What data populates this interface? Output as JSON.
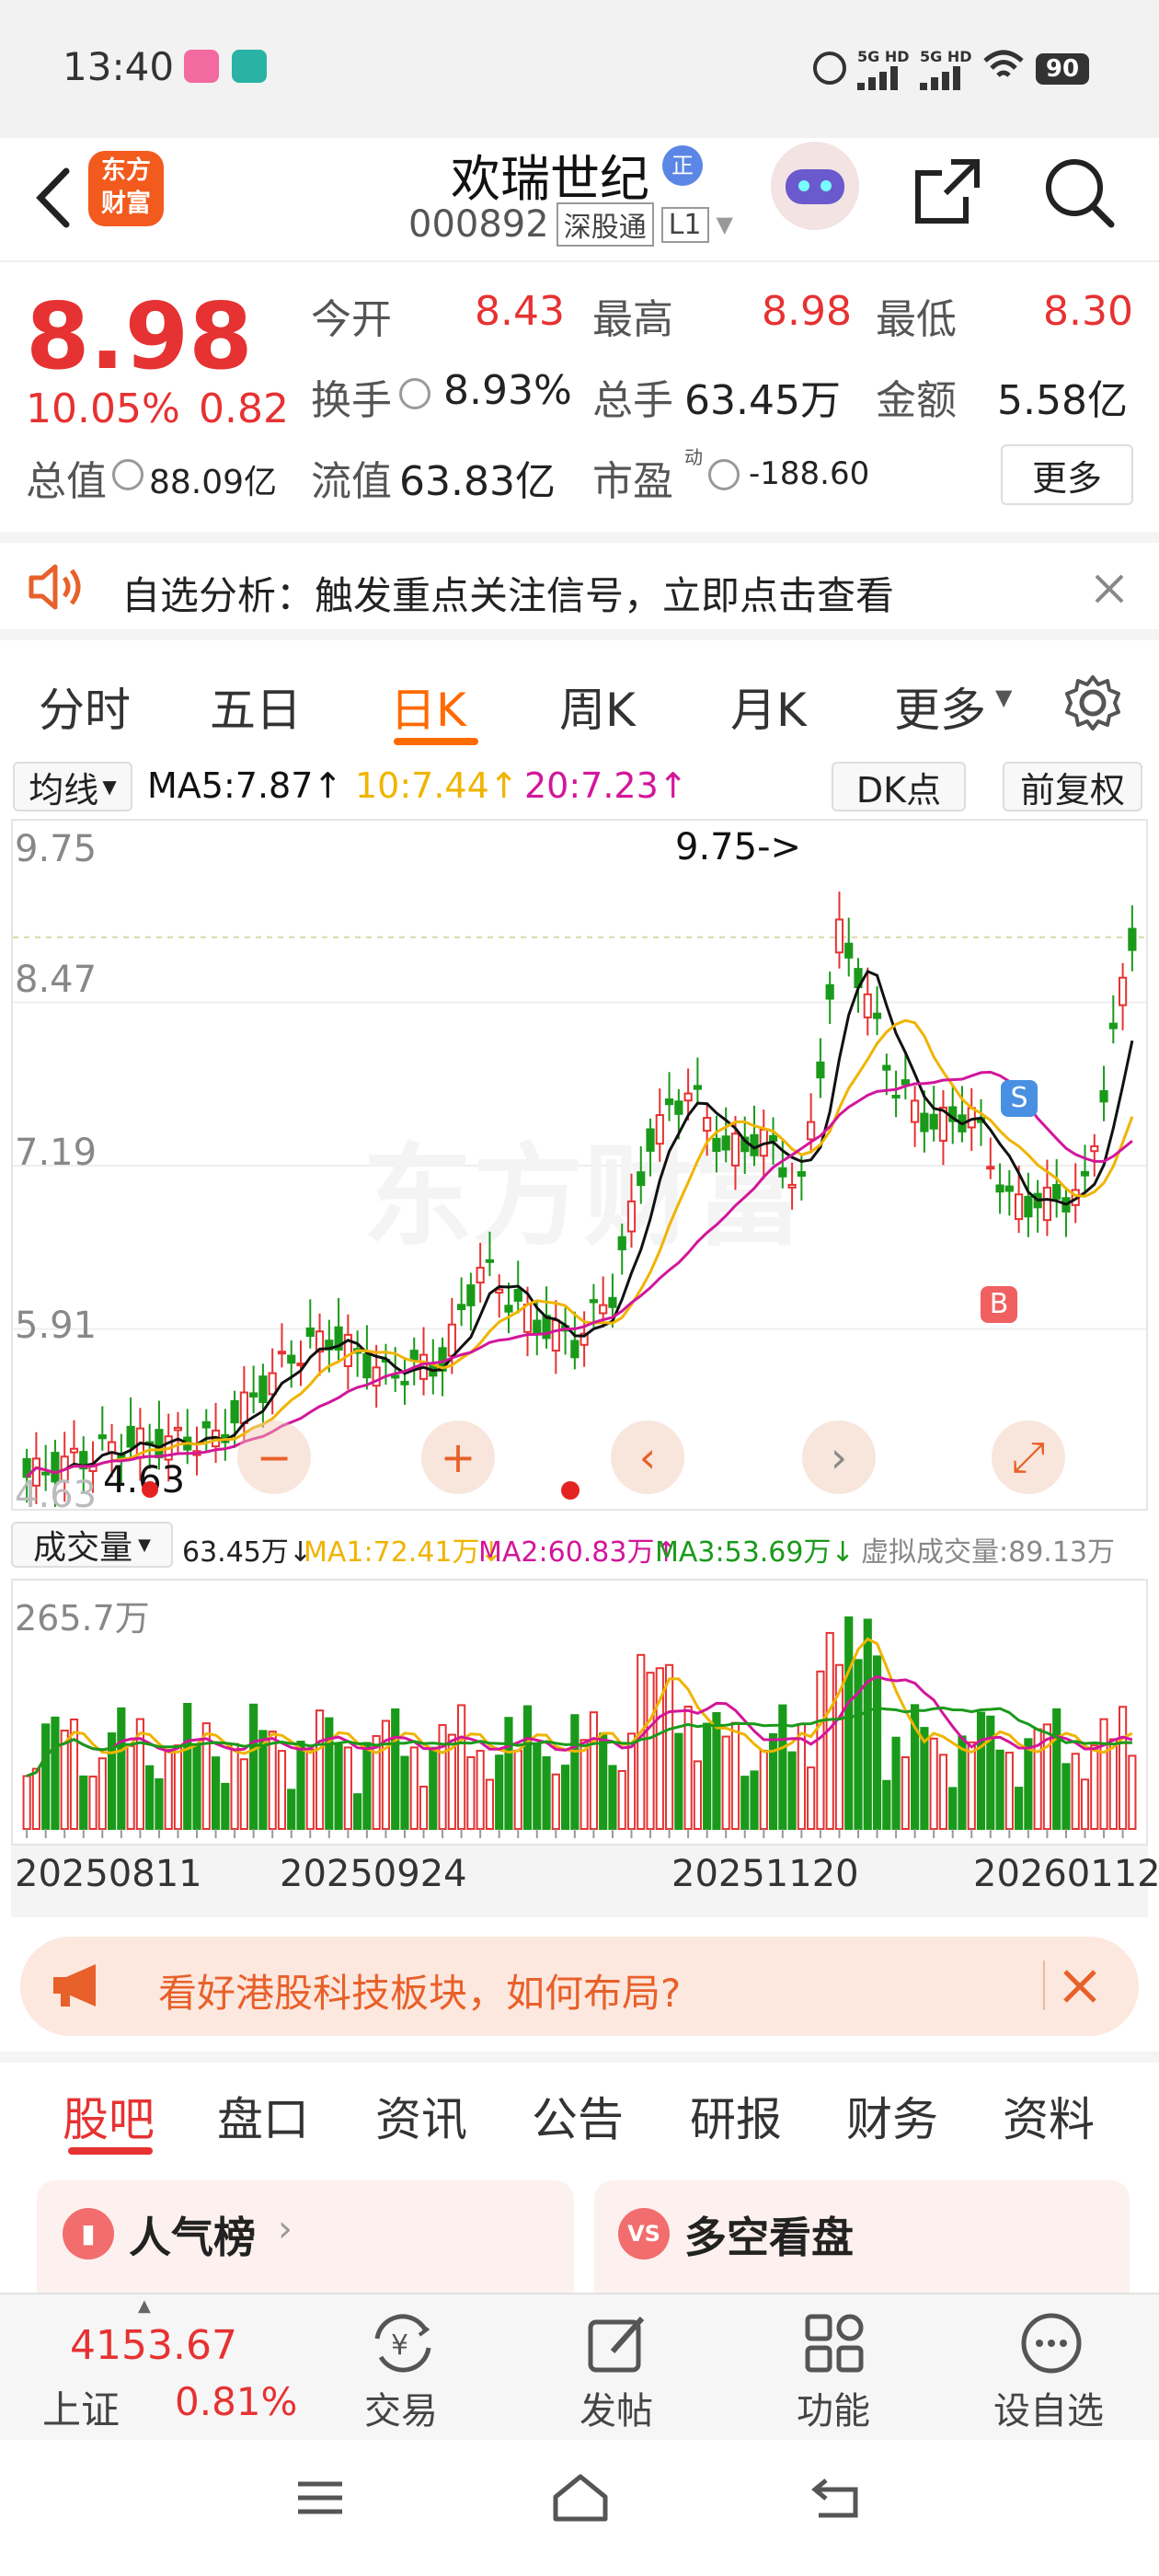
{
  "status": {
    "time": "13:40",
    "app1": "bilibili",
    "app2": "BOSS\n直聘",
    "net1": "5G HD",
    "net2": "5G HD",
    "battery": "90"
  },
  "header": {
    "logo_line1": "东方",
    "logo_line2": "财富",
    "title": "欢瑞世纪",
    "title_badge": "正",
    "code": "000892",
    "tag1": "深股通",
    "tag2": "L1"
  },
  "quote": {
    "price": "8.98",
    "pct": "10.05%",
    "chg": "0.82",
    "open_label": "今开",
    "open": "8.43",
    "high_label": "最高",
    "high": "8.98",
    "low_label": "最低",
    "low": "8.30",
    "turnover_label": "换手",
    "turnover": "8.93%",
    "vol_label": "总手",
    "vol": "63.45万",
    "amount_label": "金额",
    "amount": "5.58亿",
    "mktcap_label": "总值",
    "mktcap": "88.09亿",
    "float_label": "流值",
    "float": "63.83亿",
    "pe_label": "市盈",
    "pe_sup": "动",
    "pe": "-188.60",
    "more": "更多"
  },
  "notice": {
    "text": "自选分析：触发重点关注信号，立即点击查看"
  },
  "tabs": [
    {
      "label": "分时"
    },
    {
      "label": "五日"
    },
    {
      "label": "日K"
    },
    {
      "label": "周K"
    },
    {
      "label": "月K"
    },
    {
      "label": "更多"
    }
  ],
  "chart_toolbar": {
    "ma_select": "均线",
    "ma5": "MA5:7.87",
    "ma10": "10:7.44",
    "ma20": "20:7.23",
    "dk": "DK点",
    "fq": "前复权"
  },
  "kchart": {
    "y_labels": [
      "9.75",
      "8.47",
      "7.19",
      "5.91",
      "4.63"
    ],
    "max_annot": "9.75->",
    "min_annot": "4.63",
    "wm": "东方财富",
    "signal_s": "S",
    "signal_b": "B"
  },
  "vol_toolbar": {
    "select": "成交量",
    "vol": "63.45万",
    "ma1": "MA1:72.41万",
    "ma2": "MA2:60.83万",
    "ma3": "MA3:53.69万",
    "virtual": "虚拟成交量:89.13万"
  },
  "volchart": {
    "max": "265.7万"
  },
  "dates": [
    "20250811",
    "20250924",
    "20251120",
    "20260112"
  ],
  "ad": {
    "text": "看好港股科技板块，如何布局?"
  },
  "bottom_tabs": [
    {
      "label": "股吧"
    },
    {
      "label": "盘口"
    },
    {
      "label": "资讯"
    },
    {
      "label": "公告"
    },
    {
      "label": "研报"
    },
    {
      "label": "财务"
    },
    {
      "label": "资料"
    }
  ],
  "cards": {
    "left": "人气榜",
    "right": "多空看盘",
    "right_icon": "VS"
  },
  "bottom_bar": {
    "index_value": "4153.67",
    "index_name": "上证",
    "index_pct": "0.81%",
    "trade": "交易",
    "post": "发帖",
    "func": "功能",
    "watch": "设自选"
  },
  "colors": {
    "up": "#e63232",
    "down": "#1a9a1a",
    "accent": "#ff6a00",
    "ma5": "#111111",
    "ma10": "#f0b400",
    "ma20": "#d2169a"
  }
}
